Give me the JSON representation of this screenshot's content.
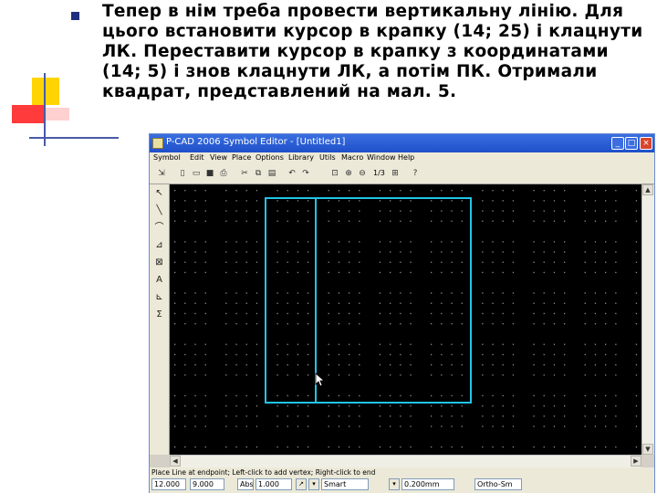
{
  "slide": {
    "text": "Тепер в нім треба провести вертикальну лінію. Для цього встановити курсор в крапку (14; 25) і клацнути ЛК. Переставити курсор в крапку з координатами (14; 5) і знов клацнути ЛК, а потім ПК. Отримали квадрат, представлений на мал. 5."
  },
  "window": {
    "title": "P-CAD 2006 Symbol Editor - [Untitled1]",
    "buttons": {
      "minimize": "_",
      "maximize": "□",
      "close": "×"
    }
  },
  "menu": [
    "Symbol",
    "Edit",
    "View",
    "Place",
    "Options",
    "Library",
    "Utils",
    "Macro",
    "Window",
    "Help"
  ],
  "toolbar": {
    "tools": [
      "select-icon",
      "new-icon",
      "open-icon",
      "save-icon",
      "print-icon",
      "cut-icon",
      "copy-icon",
      "paste-icon",
      "undo-icon",
      "redo-icon",
      "zoom-window-icon",
      "zoom-in-icon",
      "zoom-out-icon",
      "zoom-fit-icon"
    ],
    "zoom_text": "1/3"
  },
  "left_tools": [
    "select-tool-icon",
    "line-tool-icon",
    "arc-tool-icon",
    "pin-tool-icon",
    "ref-point-icon",
    "text-tool-icon",
    "attribute-icon",
    "sum-icon"
  ],
  "status": {
    "message": "Place Line at endpoint; Left-click to add vertex; Right-click to end",
    "x": "12.000",
    "y": "9.000",
    "grid_label": "Abs",
    "grid_value": "1.000",
    "line_style": "Smart",
    "width": "0.200mm",
    "mode": "Ortho-Sm"
  },
  "accent_colors": {
    "titlebar": "#2a5fd6",
    "drawn_line": "#22c4e6",
    "grid_dot": "#8c8c8c"
  }
}
